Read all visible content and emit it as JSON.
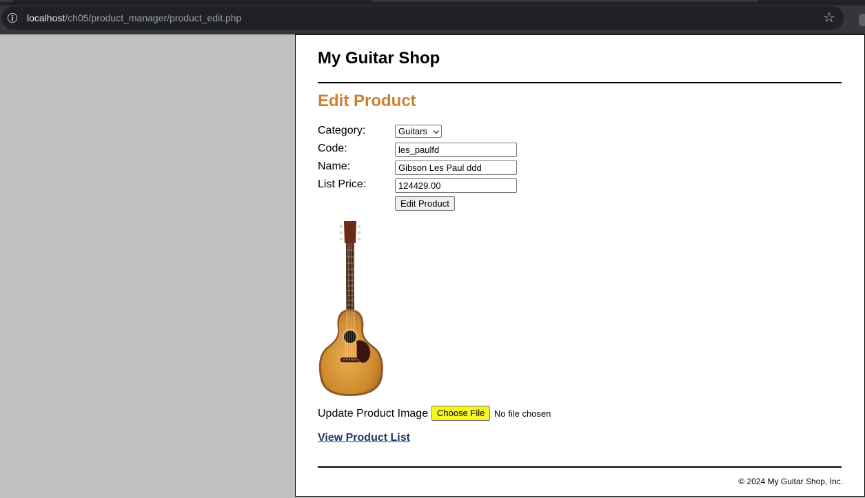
{
  "browser": {
    "url_host": "localhost",
    "url_path": "/ch05/product_manager/product_edit.php",
    "icons": [
      "site-info-icon",
      "star-icon"
    ]
  },
  "header": {
    "site_title": "My Guitar Shop"
  },
  "main": {
    "heading": "Edit Product",
    "form": {
      "category_label": "Category:",
      "category_value": "Guitars",
      "code_label": "Code:",
      "code_value": "les_paulfd",
      "name_label": "Name:",
      "name_value": "Gibson Les Paul ddd",
      "price_label": "List Price:",
      "price_value": "124429.00",
      "submit_label": "Edit Product"
    },
    "image": {
      "subject": "acoustic-guitar"
    },
    "upload": {
      "label": "Update Product Image",
      "button_label": "Choose File",
      "status": "No file chosen",
      "button_color": "#f6f627"
    },
    "view_list_link": "View Product List"
  },
  "footer": {
    "text": "© 2024 My Guitar Shop, Inc."
  },
  "colors": {
    "heading": "#cd7f32",
    "link": "#1b3a6b",
    "outside_bg": "#c0c0c0"
  }
}
